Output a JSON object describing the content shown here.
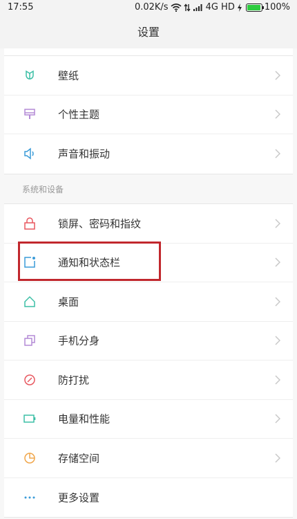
{
  "status_bar": {
    "time": "17:55",
    "network_speed": "0.02K/s",
    "network_type": "4G HD",
    "battery": "100%",
    "battery_level": 1.0
  },
  "header": {
    "title": "设置"
  },
  "group1": {
    "items": [
      {
        "label": "壁纸",
        "icon": "wallpaper-icon",
        "color": "#3cbfa6"
      },
      {
        "label": "个性主题",
        "icon": "theme-icon",
        "color": "#b48ad6"
      },
      {
        "label": "声音和振动",
        "icon": "speaker-icon",
        "color": "#3a9bd8"
      }
    ]
  },
  "section": {
    "label": "系统和设备"
  },
  "group2": {
    "items": [
      {
        "label": "锁屏、密码和指纹",
        "icon": "lock-icon",
        "color": "#e8575f"
      },
      {
        "label": "通知和状态栏",
        "icon": "notification-icon",
        "color": "#3a9bd8"
      },
      {
        "label": "桌面",
        "icon": "home-icon",
        "color": "#3cbfa6"
      },
      {
        "label": "手机分身",
        "icon": "second-space-icon",
        "color": "#b48ad6"
      },
      {
        "label": "防打扰",
        "icon": "do-not-disturb-icon",
        "color": "#e8575f"
      },
      {
        "label": "电量和性能",
        "icon": "battery-icon",
        "color": "#3cbfa6"
      },
      {
        "label": "存储空间",
        "icon": "storage-icon",
        "color": "#f0a64a"
      },
      {
        "label": "更多设置",
        "icon": "more-icon",
        "color": "#3a9bd8"
      }
    ]
  },
  "colors": {
    "highlight": "#c1272d",
    "chevron": "#c8c8c8"
  }
}
